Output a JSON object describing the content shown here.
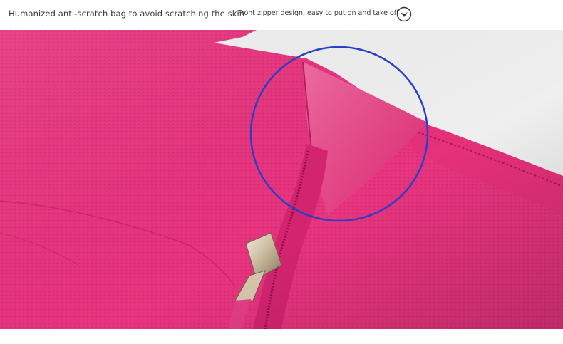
{
  "header": {
    "caption_left": "Humanized anti-scratch bag to avoid scratching the skin",
    "caption_right": "Front zipper design, easy to put on and take off",
    "badge_icon": "chevron-down-circle-icon"
  },
  "photo": {
    "subject": "pink mesh fabric collar with front zipper",
    "colors": {
      "fabric": "#e8357f",
      "fabric_dark": "#c61f66",
      "highlight_circle": "#2a3fc4",
      "zipper_pull": "#d9c9b0",
      "background": "#f2f2f2"
    }
  }
}
